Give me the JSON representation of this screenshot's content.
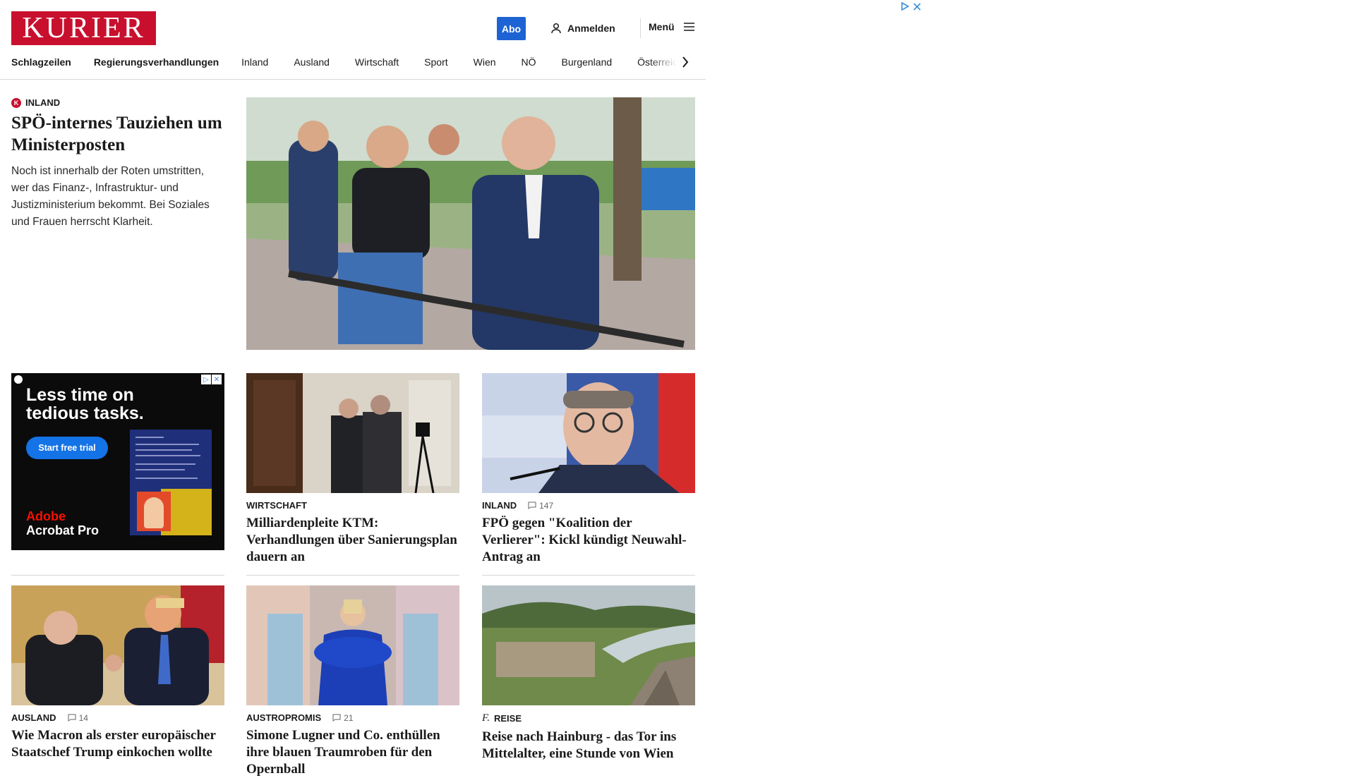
{
  "header": {
    "logo_text": "KURIER",
    "abo_label": "Abo",
    "login_label": "Anmelden",
    "menu_label": "Menü"
  },
  "nav": {
    "bold_items": [
      "Schlagzeilen",
      "Regierungsverhandlungen"
    ],
    "items": [
      "Inland",
      "Ausland",
      "Wirtschaft",
      "Sport",
      "Wien",
      "NÖ",
      "Burgenland",
      "Österreich"
    ]
  },
  "lead": {
    "section": "INLAND",
    "section_badge": "K",
    "title": "SPÖ-internes Tauziehen um Ministerposten",
    "summary": "Noch ist innerhalb der Roten umstritten, wer das Finanz-, Infrastruktur- und Justizministerium bekommt. Bei Soziales und Frauen herrscht Klarheit."
  },
  "ad": {
    "headline": "Less time on tedious tasks.",
    "button": "Start free trial",
    "brand_line1": "Adobe",
    "brand_line2": "Acrobat Pro"
  },
  "cards": [
    {
      "section": "WIRTSCHAFT",
      "comments": "",
      "title": "Milliardenpleite KTM: Verhandlungen über Sanierungsplan dauern an"
    },
    {
      "section": "INLAND",
      "comments": "147",
      "title": "FPÖ gegen \"Koalition der Verlierer\": Kickl kündigt Neuwahl-Antrag an"
    },
    {
      "section": "AUSLAND",
      "comments": "14",
      "title": "Wie Macron als erster europäischer Staatschef Trump einkochen wollte"
    },
    {
      "section": "AUSTROPROMIS",
      "comments": "21",
      "title": "Simone Lugner und Co. enthüllen ihre blauen Traumroben für den Opernball"
    },
    {
      "section": "REISE",
      "comments": "",
      "title": "Reise nach Hainburg - das Tor ins Mittelalter, eine Stunde von Wien"
    }
  ],
  "colors": {
    "brand_red": "#c8102e",
    "abo_blue": "#1e63d4"
  }
}
